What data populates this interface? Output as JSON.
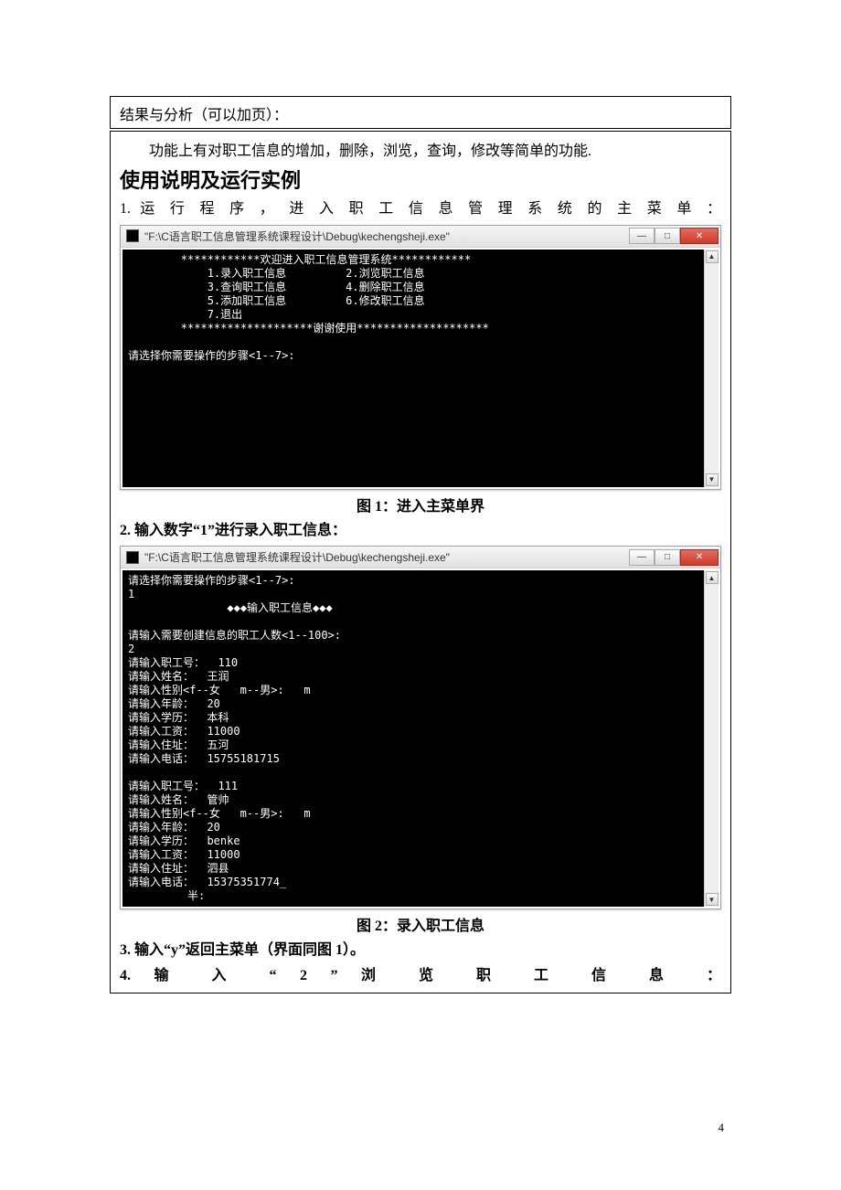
{
  "header": {
    "label": "结果与分析（可以加页）："
  },
  "intro": {
    "para": "功能上有对职工信息的增加，删除，浏览，查询，修改等简单的功能."
  },
  "section": {
    "title": "使用说明及运行实例",
    "step1": "1. 运 行 程 序 ， 进 入 职 工 信 息 管 理 系 统 的 主 菜 单 ："
  },
  "window1": {
    "title": "\"F:\\C语言职工信息管理系统课程设计\\Debug\\kechengsheji.exe\"",
    "console": "        ************欢迎进入职工信息管理系统************\n            1.录入职工信息         2.浏览职工信息\n            3.查询职工信息         4.删除职工信息\n            5.添加职工信息         6.修改职工信息\n            7.退出\n        ********************谢谢使用********************\n\n请选择你需要操作的步骤<1--7>:\n"
  },
  "caption1": "图 1：进入主菜单界",
  "step2": "2. 输入数字“1”进行录入职工信息：",
  "window2": {
    "title": "\"F:\\C语言职工信息管理系统课程设计\\Debug\\kechengsheji.exe\"",
    "console": "请选择你需要操作的步骤<1--7>:\n1\n               ◆◆◆输入职工信息◆◆◆\n\n请输入需要创建信息的职工人数<1--100>:\n2\n请输入职工号：  110\n请输入姓名：  王润\n请输入性别<f--女   m--男>:   m\n请输入年龄：  20\n请输入学历：  本科\n请输入工资：  11000\n请输入住址：  五河\n请输入电话：  15755181715\n\n请输入职工号：  111\n请输入姓名：  管帅\n请输入性别<f--女   m--男>:   m\n请输入年龄：  20\n请输入学历：  benke\n请输入工资：  11000\n请输入住址：  泗县\n请输入电话：  15375351774_\n         半:"
  },
  "caption2": "图 2：录入职工信息",
  "step3": "3. 输入“y”返回主菜单（界面同图 1）。",
  "step4": "4.    输   入   “   2   ”   浏   览   职   工   信   息   ：",
  "page_number": "4",
  "icons": {
    "min": "—",
    "max": "□",
    "close": "✕",
    "up": "▲",
    "down": "▼"
  }
}
